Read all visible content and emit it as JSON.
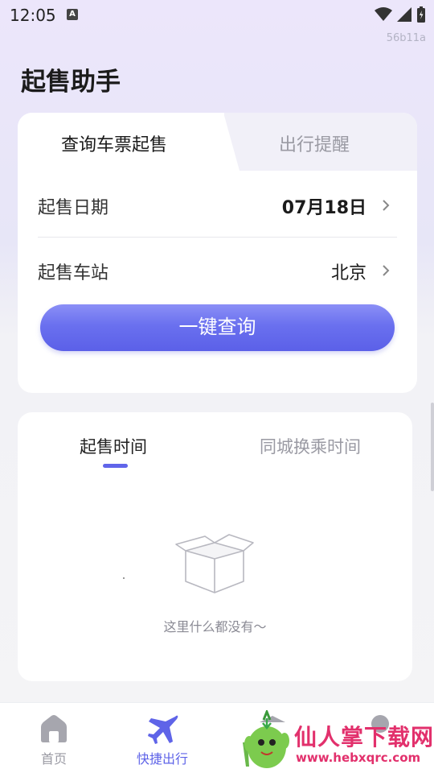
{
  "status_bar": {
    "time": "12:05",
    "notification_icon": "a-icon"
  },
  "build_tag": "56b11a",
  "page_title": "起售助手",
  "query_card": {
    "tabs": [
      {
        "label": "查询车票起售",
        "active": true
      },
      {
        "label": "出行提醒",
        "active": false
      }
    ],
    "rows": [
      {
        "label": "起售日期",
        "value": "07月18日"
      },
      {
        "label": "起售车站",
        "value": "北京"
      }
    ],
    "query_button": "一键查询"
  },
  "result_card": {
    "tabs": [
      {
        "label": "起售时间",
        "active": true
      },
      {
        "label": "同城换乘时间",
        "active": false
      }
    ],
    "empty_text": "这里什么都没有～"
  },
  "bottom_nav": [
    {
      "label": "首页",
      "icon": "home-icon",
      "active": false
    },
    {
      "label": "快捷出行",
      "icon": "plane-icon",
      "active": true
    },
    {
      "label": "",
      "icon": "download-icon",
      "active": false
    },
    {
      "label": "",
      "icon": "profile-icon",
      "active": false
    }
  ],
  "watermark": {
    "brand": "仙人掌下载网",
    "url": "www.hebxqrc.com"
  },
  "colors": {
    "accent": "#5f64e8",
    "button_start": "#8b8ff6",
    "button_end": "#5b60e8",
    "watermark": "#e2306c"
  }
}
